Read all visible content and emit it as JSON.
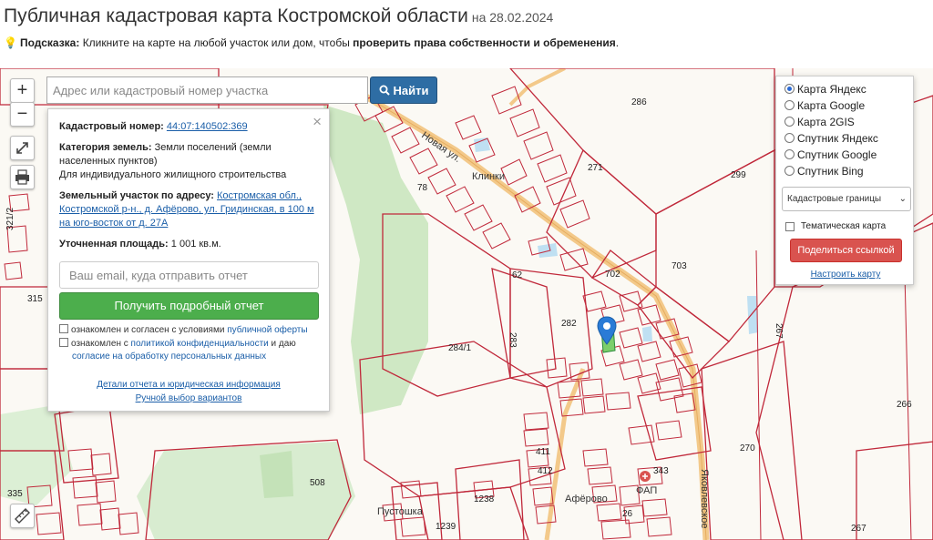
{
  "header": {
    "title": "Публичная кадастровая карта Костромской области",
    "date": "на 28.02.2024",
    "hint_label": "Подсказка:",
    "hint_text": " Кликните на карте на любой участок или дом, чтобы ",
    "hint_bold": "проверить права собственности и обременения",
    "hint_end": "."
  },
  "map_controls": {
    "zoom_in": "+",
    "zoom_out": "−",
    "fullscreen_icon": "expand-icon",
    "print_icon": "printer-icon",
    "ruler_icon": "ruler-icon"
  },
  "search": {
    "placeholder": "Адрес или кадастровый номер участка",
    "button_label": "Найти"
  },
  "info": {
    "cadastral_label": "Кадастровый номер:",
    "cadastral_value": "44:07:140502:369",
    "category_label": "Категория земель:",
    "category_value_1": "Земли поселений (земли",
    "category_value_2": "населенных пунктов)",
    "category_value_3": "Для индивидуального жилищного строительства",
    "address_label": "Земельный участок по адресу:",
    "address_value_1": "Костромская обл.,",
    "address_value_2": "Костромской р-н., д. Афёрово, ул. Гридинская, в 100 м",
    "address_value_3": "на юго-восток от д. 27А",
    "area_label": "Уточненная площадь:",
    "area_value": "1 001 кв.м.",
    "email_placeholder": "Ваш email, куда отправить отчет",
    "report_button": "Получить подробный отчет",
    "consent1_text": "ознакомлен и согласен с условиями ",
    "consent1_link": "публичной оферты",
    "consent2_text": "ознакомлен с ",
    "consent2_link1": "политикой конфиденциальности",
    "consent2_mid": " и даю",
    "consent2_link2": "согласие на обработку персональных данных",
    "details_link": "Детали отчета и юридическая информация",
    "manual_link": "Ручной выбор вариантов"
  },
  "layers": {
    "options": [
      {
        "label": "Карта Яндекс",
        "selected": true
      },
      {
        "label": "Карта Google",
        "selected": false
      },
      {
        "label": "Карта 2GIS",
        "selected": false
      },
      {
        "label": "Спутник Яндекс",
        "selected": false
      },
      {
        "label": "Спутник Google",
        "selected": false
      },
      {
        "label": "Спутник Bing",
        "selected": false
      }
    ],
    "select_value": "Кадастровые границы",
    "thematic_label": "Тематическая карта",
    "share_button": "Поделиться ссылкой",
    "setup_link": "Настроить карту"
  },
  "map_labels": {
    "parcels": [
      "286",
      "271",
      "299",
      "703",
      "702",
      "282",
      "283",
      "284/1",
      "315",
      "508",
      "1238",
      "1239",
      "270",
      "266",
      "267",
      "343",
      "411",
      "412",
      "26",
      "62",
      "78",
      "335",
      "321/2",
      "267"
    ],
    "places": [
      "Клинки",
      "Новая ул.",
      "Афёрово",
      "ФАП",
      "Пустошка",
      "Яковлевское"
    ]
  },
  "colors": {
    "parcel_border": "#c0283a",
    "forest": "#cfe8c4",
    "road": "#f3c98a",
    "search_button": "#2e6da4",
    "report_button": "#4cae4c",
    "share_button": "#d9534f",
    "marker": "#2a7bd6"
  }
}
